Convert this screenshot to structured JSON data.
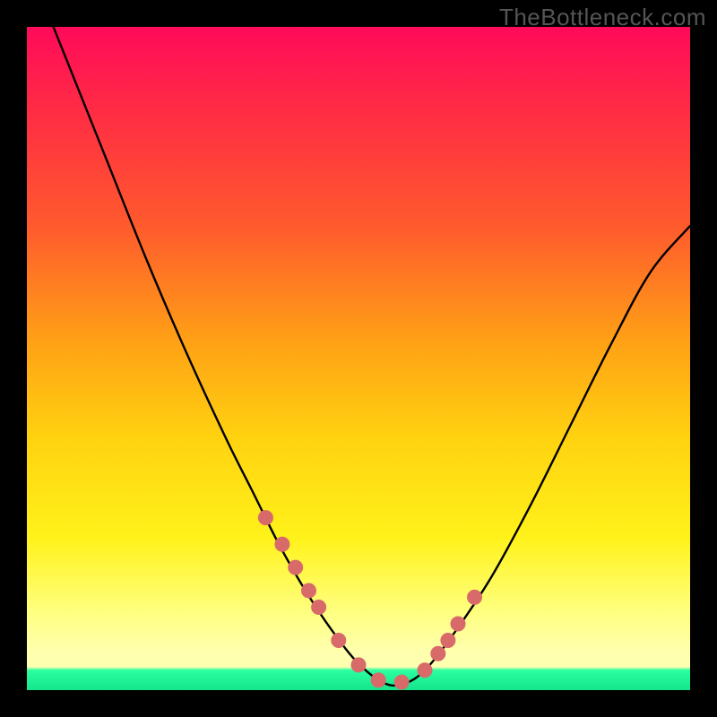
{
  "watermark": "TheBottleneck.com",
  "chart_data": {
    "type": "line",
    "title": "",
    "xlabel": "",
    "ylabel": "",
    "xlim": [
      0,
      100
    ],
    "ylim": [
      0,
      100
    ],
    "series": [
      {
        "name": "bottleneck-curve",
        "x": [
          0,
          6,
          12,
          18,
          24,
          30,
          34,
          38,
          42,
          46,
          50,
          54,
          57,
          60,
          64,
          70,
          76,
          82,
          88,
          94,
          100
        ],
        "y": [
          110,
          95,
          80,
          65,
          51,
          38,
          30,
          22,
          15,
          9,
          4,
          1,
          1,
          3,
          8,
          17,
          28,
          40,
          52,
          63,
          70
        ]
      }
    ],
    "markers": {
      "name": "highlighted-points",
      "x": [
        36,
        38.5,
        40.5,
        42.5,
        44,
        47,
        50,
        53,
        56.5,
        60,
        62,
        63.5,
        65,
        67.5
      ],
      "y": [
        26,
        22,
        18.5,
        15,
        12.5,
        7.5,
        3.8,
        1.5,
        1.2,
        3,
        5.5,
        7.5,
        10,
        14
      ]
    },
    "background_gradient": {
      "stops": [
        {
          "pos": 0,
          "color": "#ff0a5a"
        },
        {
          "pos": 0.12,
          "color": "#ff2a45"
        },
        {
          "pos": 0.3,
          "color": "#ff5a2d"
        },
        {
          "pos": 0.48,
          "color": "#ffa315"
        },
        {
          "pos": 0.62,
          "color": "#ffd210"
        },
        {
          "pos": 0.77,
          "color": "#fff21a"
        },
        {
          "pos": 0.88,
          "color": "#ffff7e"
        },
        {
          "pos": 0.965,
          "color": "#ffffb0"
        },
        {
          "pos": 0.97,
          "color": "#2bffa0"
        },
        {
          "pos": 1.0,
          "color": "#14e58c"
        }
      ]
    }
  }
}
